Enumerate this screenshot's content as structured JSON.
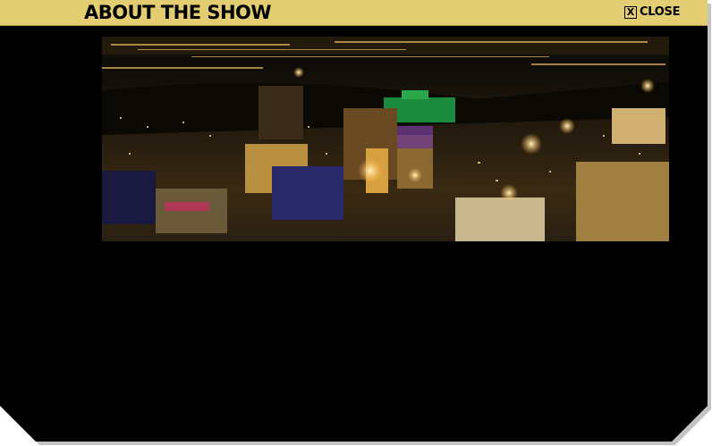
{
  "dialog": {
    "title": "ABOUT THE SHOW",
    "close_label": "CLOSE",
    "close_icon": "x-box-icon"
  },
  "photo": {
    "subject": "las-vegas-strip-night-aerial-photo"
  },
  "colors": {
    "title_bar": "#e3cd73",
    "panel": "#000000"
  }
}
